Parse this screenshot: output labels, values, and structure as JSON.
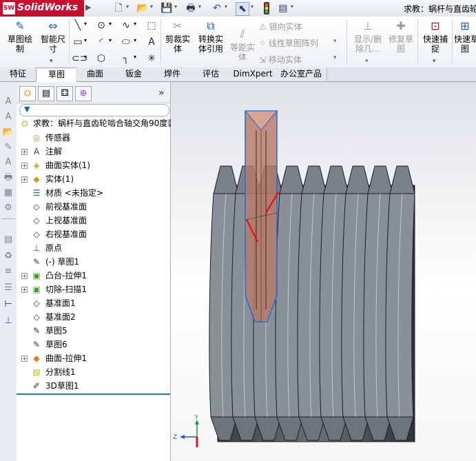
{
  "app": {
    "name": "SolidWorks",
    "logo_mark": "SW",
    "title": "求教：蜗杆与直齿轮"
  },
  "quick_access": [
    "new-icon",
    "open-icon",
    "save-icon",
    "print-icon",
    "undo-icon",
    "select-icon",
    "traffic-light-icon",
    "options-icon"
  ],
  "ribbon": {
    "sketch_draw": "草图绘\n制",
    "smart_dim": "智能尺\n寸",
    "trim": "剪裁实\n体",
    "convert": "转换实\n体引用",
    "offset": "等距实\n体",
    "mirror": "镜向实体",
    "linear_pattern": "线性草图阵列",
    "move": "移动实体",
    "show_delete": "显示/删\n除几…",
    "repair": "修复草\n图",
    "quick_snap": "快速捕\n捉",
    "quick_view": "快速草\n图"
  },
  "tabs": [
    "特征",
    "草图",
    "曲面",
    "钣金",
    "焊件",
    "评估",
    "DimXpert",
    "办公室产品"
  ],
  "active_tab": 1,
  "tree": {
    "root": "求教：蜗杆与直齿轮啮合轴交角90度装",
    "items": [
      {
        "label": "传感器",
        "icon": "sensor-icon",
        "expand": false
      },
      {
        "label": "注解",
        "icon": "annotation-icon",
        "expand": true
      },
      {
        "label": "曲面实体(1)",
        "icon": "surface-bodies-icon",
        "expand": true
      },
      {
        "label": "实体(1)",
        "icon": "solid-bodies-icon",
        "expand": true
      },
      {
        "label": "材质 <未指定>",
        "icon": "material-icon",
        "expand": false
      },
      {
        "label": "前视基准面",
        "icon": "plane-icon",
        "expand": false
      },
      {
        "label": "上视基准面",
        "icon": "plane-icon",
        "expand": false
      },
      {
        "label": "右视基准面",
        "icon": "plane-icon",
        "expand": false
      },
      {
        "label": "原点",
        "icon": "origin-icon",
        "expand": false
      },
      {
        "label": "(-) 草图1",
        "icon": "sketch-icon",
        "expand": false
      },
      {
        "label": "凸台-拉伸1",
        "icon": "boss-extrude-icon",
        "expand": true
      },
      {
        "label": "切除-扫描1",
        "icon": "cut-sweep-icon",
        "expand": true
      },
      {
        "label": "基准面1",
        "icon": "plane-icon",
        "expand": false
      },
      {
        "label": "基准面2",
        "icon": "plane-icon",
        "expand": false
      },
      {
        "label": "草图5",
        "icon": "sketch-icon",
        "expand": false
      },
      {
        "label": "草图6",
        "icon": "sketch-icon",
        "expand": false
      },
      {
        "label": "曲面-拉伸1",
        "icon": "surface-extrude-icon",
        "expand": true
      },
      {
        "label": "分割线1",
        "icon": "split-line-icon",
        "expand": false
      },
      {
        "label": "3D草图1",
        "icon": "3d-sketch-icon",
        "expand": false
      }
    ]
  },
  "triad": {
    "y": "Y",
    "z": "Z"
  },
  "colors": {
    "accent": "#2b6fb6",
    "logo": "#c8102e",
    "thread": "#5e636b",
    "cutter": "#b06e5c"
  }
}
